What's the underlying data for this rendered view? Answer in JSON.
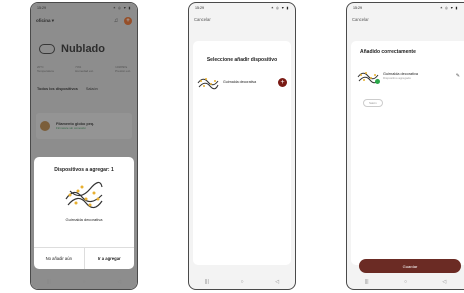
{
  "status_time": "15:29",
  "status_right": "✶ ◎ ▼ ▮",
  "nav_icons": [
    "|||",
    "○",
    "◁"
  ],
  "screen1": {
    "home_name": "oficina",
    "weather_label": "Nublado",
    "stat1_value": "20°C",
    "stat1_label": "Temperatura",
    "stat2_value": "74%",
    "stat2_label": "Humedad ext.",
    "stat3_value": "1018hPa",
    "stat3_label": "Presión ext.",
    "tab_all": "Todos los dispositivos",
    "tab_room": "Salaón",
    "device_name": "Filamento globo peq.",
    "device_status": "Firmware sin conexión",
    "sheet_title": "Dispositivos a agregar: 1",
    "sheet_device": "Guirnalda decorativa",
    "btn_no": "No añadir aún",
    "btn_add": "Ir a agregar"
  },
  "screen2": {
    "cancel": "Cancelar",
    "title": "Seleccione añadir dispositivo",
    "device": "Guirnalda decorativa"
  },
  "screen3": {
    "cancel": "Cancelar",
    "title": "Añadido correctamente",
    "device": "Guirnalda decorativa",
    "device_sub": "Dispositivo agregado",
    "room": "Salón",
    "save": "Guardar"
  },
  "colors": {
    "accent_orange": "#e0601a",
    "maroon": "#7a1a14",
    "success": "#2aa84a"
  }
}
